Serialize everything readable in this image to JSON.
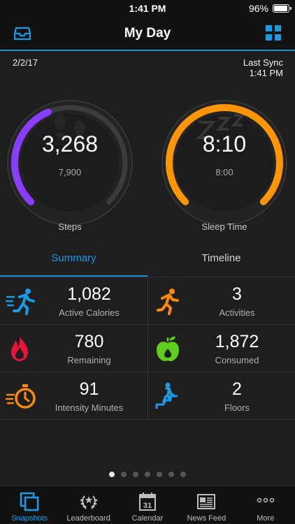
{
  "status_bar": {
    "time": "1:41 PM",
    "battery": "96%",
    "battery_level": 0.96
  },
  "nav": {
    "title": "My Day",
    "left_icon": "inbox-icon",
    "right_icon": "grid-icon"
  },
  "header": {
    "date": "2/2/17",
    "last_sync_label": "Last Sync",
    "last_sync_time": "1:41 PM"
  },
  "gauges": {
    "steps": {
      "value": "3,268",
      "goal": "7,900",
      "label": "Steps",
      "progress": 0.414,
      "color": "#8b3dff",
      "icon": "footprints-icon"
    },
    "sleep": {
      "value": "8:10",
      "goal": "8:00",
      "label": "Sleep Time",
      "progress": 1.0,
      "color": "#ff9500",
      "icon": "zzz-icon"
    }
  },
  "tabs": [
    {
      "label": "Summary",
      "active": true
    },
    {
      "label": "Timeline",
      "active": false
    }
  ],
  "tiles": [
    {
      "value": "1,082",
      "label": "Active Calories",
      "icon": "running-fast-icon",
      "color": "#1a9be6"
    },
    {
      "value": "3",
      "label": "Activities",
      "icon": "runner-icon",
      "color": "#ff8a00"
    },
    {
      "value": "780",
      "label": "Remaining",
      "icon": "flame-icon",
      "color": "#e8143c"
    },
    {
      "value": "1,872",
      "label": "Consumed",
      "icon": "apple-icon",
      "color": "#5fce1a"
    },
    {
      "value": "91",
      "label": "Intensity Minutes",
      "icon": "stopwatch-icon",
      "color": "#ff8a00"
    },
    {
      "value": "2",
      "label": "Floors",
      "icon": "stairs-icon",
      "color": "#1a9be6"
    }
  ],
  "pager": {
    "count": 7,
    "active": 0
  },
  "tab_bar": [
    {
      "label": "Snapshots",
      "icon": "snapshots-icon",
      "active": true
    },
    {
      "label": "Leaderboard",
      "icon": "laurel-icon",
      "active": false
    },
    {
      "label": "Calendar",
      "icon": "calendar-icon",
      "calendar_day": "31",
      "active": false
    },
    {
      "label": "News Feed",
      "icon": "newspaper-icon",
      "active": false
    },
    {
      "label": "More",
      "icon": "more-icon",
      "active": false
    }
  ],
  "colors": {
    "accent": "#1a9be6",
    "background": "#1e1e1e",
    "bar": "#121212"
  }
}
